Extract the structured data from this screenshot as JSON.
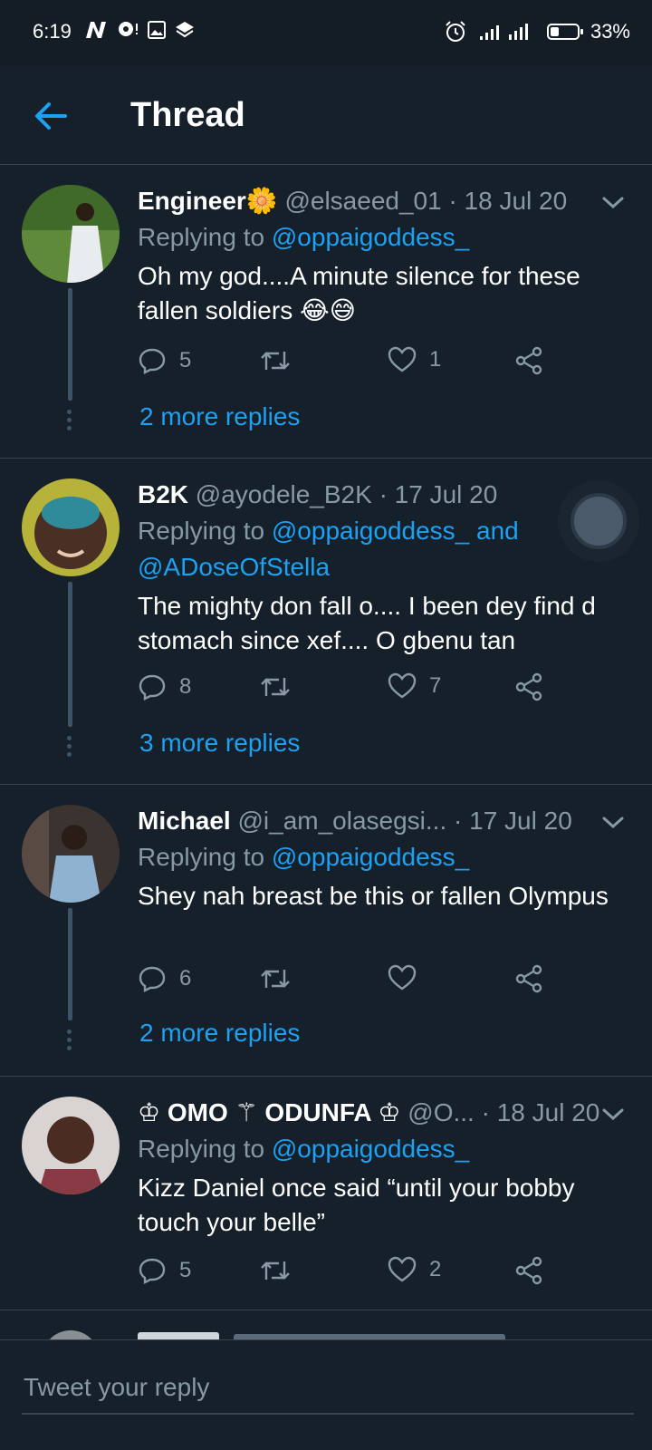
{
  "status": {
    "time": "6:19",
    "battery": "33%",
    "battery_level": 0.33
  },
  "header": {
    "title": "Thread"
  },
  "tweets": [
    {
      "name": "Engineer🌼",
      "handle": "@elsaeed_01 · 18 Jul 20",
      "replying_prefix": "Replying to ",
      "replying_to": "@oppaigoddess_",
      "body": "Oh my god....A minute silence for these fallen soldiers 😂😅",
      "reply_count": "5",
      "like_count": "1",
      "more": "2 more replies"
    },
    {
      "name": "B2K",
      "handle": "@ayodele_B2K · 17 Jul 20",
      "replying_prefix": "Replying to ",
      "replying_to": "@oppaigoddess_ and @ADoseOfStella",
      "body": "The mighty don fall o.... I been dey find d stomach since xef.... O gbenu tan",
      "reply_count": "8",
      "like_count": "7",
      "more": "3 more replies"
    },
    {
      "name": "Michael",
      "handle": "@i_am_olasegsi... · 17 Jul 20",
      "replying_prefix": "Replying to ",
      "replying_to": "@oppaigoddess_",
      "body": "Shey nah breast be this or fallen Olympus",
      "reply_count": "6",
      "like_count": "",
      "more": "2 more replies"
    },
    {
      "name": "♔ OMO ⚚ ODUNFA ♔",
      "handle": "@O... · 18 Jul 20",
      "replying_prefix": "Replying to ",
      "replying_to": "@oppaigoddess_",
      "body": "Kizz Daniel once said “until your bobby touch your belle”",
      "reply_count": "5",
      "like_count": "2"
    }
  ],
  "composer": {
    "placeholder": "Tweet your reply"
  },
  "colors": {
    "background": "#15202b",
    "accent": "#1da1f2",
    "muted": "#8899a6",
    "divider": "#38444d"
  }
}
